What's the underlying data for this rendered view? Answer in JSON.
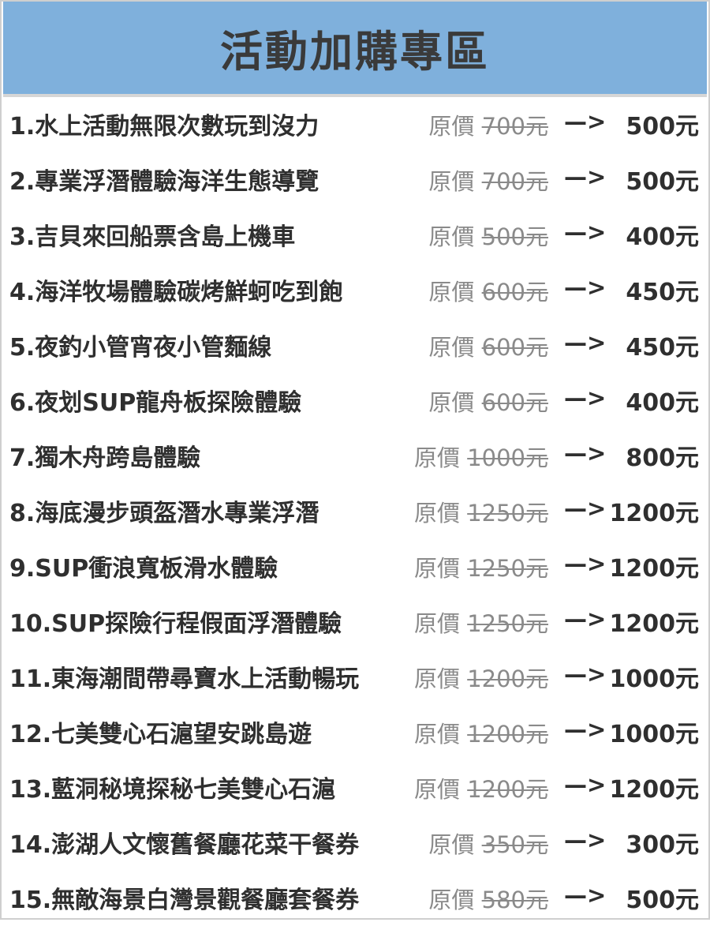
{
  "header": {
    "title": "活動加購專區"
  },
  "items": [
    {
      "name": "1.水上活動無限次數玩到沒力",
      "orig_label": "原價",
      "orig_price": "700元",
      "arrow": "—>",
      "sale_price": "500元"
    },
    {
      "name": "2.專業浮潛體驗海洋生態導覽",
      "orig_label": "原價",
      "orig_price": "700元",
      "arrow": "—>",
      "sale_price": "500元"
    },
    {
      "name": "3.吉貝來回船票含島上機車",
      "orig_label": "原價",
      "orig_price": "500元",
      "arrow": "—>",
      "sale_price": "400元"
    },
    {
      "name": "4.海洋牧場體驗碳烤鮮蚵吃到飽",
      "orig_label": "原價",
      "orig_price": "600元",
      "arrow": "—>",
      "sale_price": "450元"
    },
    {
      "name": "5.夜釣小管宵夜小管麵線",
      "orig_label": "原價",
      "orig_price": "600元",
      "arrow": "—>",
      "sale_price": "450元"
    },
    {
      "name": "6.夜划SUP龍舟板探險體驗",
      "orig_label": "原價",
      "orig_price": "600元",
      "arrow": "—>",
      "sale_price": "400元"
    },
    {
      "name": "7.獨木舟跨島體驗",
      "orig_label": "原價",
      "orig_price": "1000元",
      "arrow": "—>",
      "sale_price": "800元"
    },
    {
      "name": "8.海底漫步頭盔潛水專業浮潛",
      "orig_label": "原價",
      "orig_price": "1250元",
      "arrow": "—>",
      "sale_price": "1200元"
    },
    {
      "name": "9.SUP衝浪寬板滑水體驗",
      "orig_label": "原價",
      "orig_price": "1250元",
      "arrow": "—>",
      "sale_price": "1200元"
    },
    {
      "name": "10.SUP探險行程假面浮潛體驗",
      "orig_label": "原價",
      "orig_price": "1250元",
      "arrow": "—>",
      "sale_price": "1200元"
    },
    {
      "name": "11.東海潮間帶尋寶水上活動暢玩",
      "orig_label": "原價",
      "orig_price": "1200元",
      "arrow": "—>",
      "sale_price": "1000元"
    },
    {
      "name": "12.七美雙心石滬望安跳島遊",
      "orig_label": "原價",
      "orig_price": "1200元",
      "arrow": "—>",
      "sale_price": "1000元"
    },
    {
      "name": "13.藍洞秘境探秘七美雙心石滬",
      "orig_label": "原價",
      "orig_price": "1200元",
      "arrow": "—>",
      "sale_price": "1200元"
    },
    {
      "name": "14.澎湖人文懷舊餐廳花菜干餐券",
      "orig_label": "原價",
      "orig_price": "350元",
      "arrow": "—>",
      "sale_price": "300元"
    },
    {
      "name": "15.無敵海景白灣景觀餐廳套餐券",
      "orig_label": "原價",
      "orig_price": "580元",
      "arrow": "—>",
      "sale_price": "500元"
    }
  ]
}
